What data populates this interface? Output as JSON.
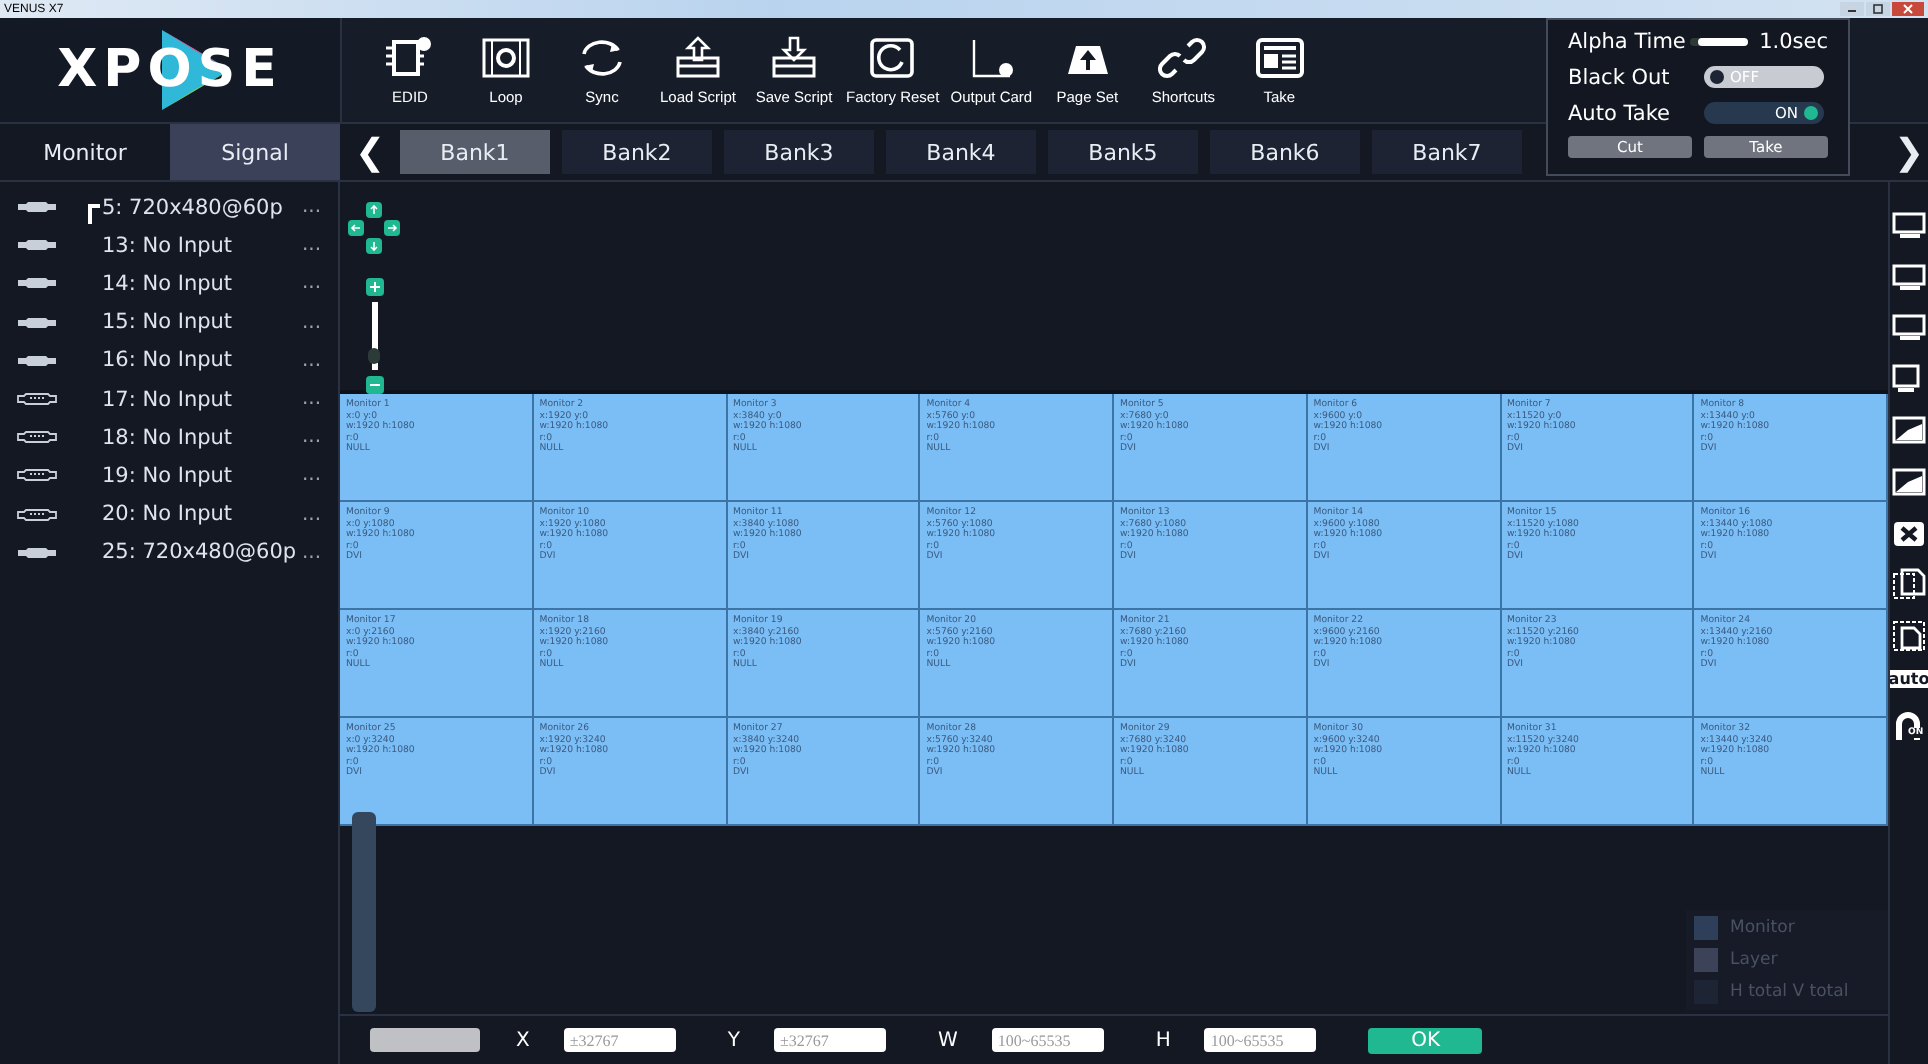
{
  "window": {
    "title": "VENUS X7"
  },
  "logo": {
    "text": "XPOSE"
  },
  "toolbar": [
    {
      "label": "EDID",
      "kind": "chip"
    },
    {
      "label": "Loop",
      "kind": "film"
    },
    {
      "label": "Sync",
      "kind": "sync"
    },
    {
      "label": "Load Script",
      "kind": "load"
    },
    {
      "label": "Save Script",
      "kind": "save"
    },
    {
      "label": "Factory Reset",
      "kind": "reset"
    },
    {
      "label": "Output Card",
      "kind": "card"
    },
    {
      "label": "Page Set",
      "kind": "cloud"
    },
    {
      "label": "Shortcuts",
      "kind": "link"
    },
    {
      "label": "Take",
      "kind": "take"
    }
  ],
  "left_tabs": [
    {
      "label": "Monitor",
      "selected": false
    },
    {
      "label": "Signal",
      "selected": true
    }
  ],
  "bank_nav": {
    "prev": "❮",
    "next": "❯"
  },
  "banks": [
    {
      "label": "Bank1",
      "selected": true
    },
    {
      "label": "Bank2",
      "selected": false
    },
    {
      "label": "Bank3",
      "selected": false
    },
    {
      "label": "Bank4",
      "selected": false
    },
    {
      "label": "Bank5",
      "selected": false
    },
    {
      "label": "Bank6",
      "selected": false
    },
    {
      "label": "Bank7",
      "selected": false
    }
  ],
  "signals": [
    {
      "label": "5: 720x480@60p",
      "kind": "hdmi",
      "selected": true,
      "menu": "..."
    },
    {
      "label": "13: No Input",
      "kind": "hdmi",
      "selected": false,
      "menu": "..."
    },
    {
      "label": "14: No Input",
      "kind": "hdmi",
      "selected": false,
      "menu": "..."
    },
    {
      "label": "15: No Input",
      "kind": "hdmi",
      "selected": false,
      "menu": "..."
    },
    {
      "label": "16: No Input",
      "kind": "hdmi",
      "selected": false,
      "menu": "..."
    },
    {
      "label": "17: No Input",
      "kind": "dvi",
      "selected": false,
      "menu": "..."
    },
    {
      "label": "18: No Input",
      "kind": "dvi",
      "selected": false,
      "menu": "..."
    },
    {
      "label": "19: No Input",
      "kind": "dvi",
      "selected": false,
      "menu": "..."
    },
    {
      "label": "20: No Input",
      "kind": "dvi",
      "selected": false,
      "menu": "..."
    },
    {
      "label": "25: 720x480@60p",
      "kind": "hdmi",
      "selected": false,
      "menu": "..."
    }
  ],
  "zoom": {
    "level": 0.1
  },
  "monitors": [
    {
      "title": "Monitor 1",
      "position": "x:0 y:0",
      "size": "w:1920 h:1080",
      "rotation": "r:0",
      "signal": "NULL"
    },
    {
      "title": "Monitor 2",
      "position": "x:1920 y:0",
      "size": "w:1920 h:1080",
      "rotation": "r:0",
      "signal": "NULL"
    },
    {
      "title": "Monitor 3",
      "position": "x:3840 y:0",
      "size": "w:1920 h:1080",
      "rotation": "r:0",
      "signal": "NULL"
    },
    {
      "title": "Monitor 4",
      "position": "x:5760 y:0",
      "size": "w:1920 h:1080",
      "rotation": "r:0",
      "signal": "NULL"
    },
    {
      "title": "Monitor 5",
      "position": "x:7680 y:0",
      "size": "w:1920 h:1080",
      "rotation": "r:0",
      "signal": "DVI"
    },
    {
      "title": "Monitor 6",
      "position": "x:9600 y:0",
      "size": "w:1920 h:1080",
      "rotation": "r:0",
      "signal": "DVI"
    },
    {
      "title": "Monitor 7",
      "position": "x:11520 y:0",
      "size": "w:1920 h:1080",
      "rotation": "r:0",
      "signal": "DVI"
    },
    {
      "title": "Monitor 8",
      "position": "x:13440 y:0",
      "size": "w:1920 h:1080",
      "rotation": "r:0",
      "signal": "DVI"
    },
    {
      "title": "Monitor 9",
      "position": "x:0 y:1080",
      "size": "w:1920 h:1080",
      "rotation": "r:0",
      "signal": "DVI"
    },
    {
      "title": "Monitor 10",
      "position": "x:1920 y:1080",
      "size": "w:1920 h:1080",
      "rotation": "r:0",
      "signal": "DVI"
    },
    {
      "title": "Monitor 11",
      "position": "x:3840 y:1080",
      "size": "w:1920 h:1080",
      "rotation": "r:0",
      "signal": "DVI"
    },
    {
      "title": "Monitor 12",
      "position": "x:5760 y:1080",
      "size": "w:1920 h:1080",
      "rotation": "r:0",
      "signal": "DVI"
    },
    {
      "title": "Monitor 13",
      "position": "x:7680 y:1080",
      "size": "w:1920 h:1080",
      "rotation": "r:0",
      "signal": "DVI"
    },
    {
      "title": "Monitor 14",
      "position": "x:9600 y:1080",
      "size": "w:1920 h:1080",
      "rotation": "r:0",
      "signal": "DVI"
    },
    {
      "title": "Monitor 15",
      "position": "x:11520 y:1080",
      "size": "w:1920 h:1080",
      "rotation": "r:0",
      "signal": "DVI"
    },
    {
      "title": "Monitor 16",
      "position": "x:13440 y:1080",
      "size": "w:1920 h:1080",
      "rotation": "r:0",
      "signal": "DVI"
    },
    {
      "title": "Monitor 17",
      "position": "x:0 y:2160",
      "size": "w:1920 h:1080",
      "rotation": "r:0",
      "signal": "NULL"
    },
    {
      "title": "Monitor 18",
      "position": "x:1920 y:2160",
      "size": "w:1920 h:1080",
      "rotation": "r:0",
      "signal": "NULL"
    },
    {
      "title": "Monitor 19",
      "position": "x:3840 y:2160",
      "size": "w:1920 h:1080",
      "rotation": "r:0",
      "signal": "NULL"
    },
    {
      "title": "Monitor 20",
      "position": "x:5760 y:2160",
      "size": "w:1920 h:1080",
      "rotation": "r:0",
      "signal": "NULL"
    },
    {
      "title": "Monitor 21",
      "position": "x:7680 y:2160",
      "size": "w:1920 h:1080",
      "rotation": "r:0",
      "signal": "DVI"
    },
    {
      "title": "Monitor 22",
      "position": "x:9600 y:2160",
      "size": "w:1920 h:1080",
      "rotation": "r:0",
      "signal": "DVI"
    },
    {
      "title": "Monitor 23",
      "position": "x:11520 y:2160",
      "size": "w:1920 h:1080",
      "rotation": "r:0",
      "signal": "DVI"
    },
    {
      "title": "Monitor 24",
      "position": "x:13440 y:2160",
      "size": "w:1920 h:1080",
      "rotation": "r:0",
      "signal": "DVI"
    },
    {
      "title": "Monitor 25",
      "position": "x:0 y:3240",
      "size": "w:1920 h:1080",
      "rotation": "r:0",
      "signal": "DVI"
    },
    {
      "title": "Monitor 26",
      "position": "x:1920 y:3240",
      "size": "w:1920 h:1080",
      "rotation": "r:0",
      "signal": "DVI"
    },
    {
      "title": "Monitor 27",
      "position": "x:3840 y:3240",
      "size": "w:1920 h:1080",
      "rotation": "r:0",
      "signal": "DVI"
    },
    {
      "title": "Monitor 28",
      "position": "x:5760 y:3240",
      "size": "w:1920 h:1080",
      "rotation": "r:0",
      "signal": "DVI"
    },
    {
      "title": "Monitor 29",
      "position": "x:7680 y:3240",
      "size": "w:1920 h:1080",
      "rotation": "r:0",
      "signal": "NULL"
    },
    {
      "title": "Monitor 30",
      "position": "x:9600 y:3240",
      "size": "w:1920 h:1080",
      "rotation": "r:0",
      "signal": "NULL"
    },
    {
      "title": "Monitor 31",
      "position": "x:11520 y:3240",
      "size": "w:1920 h:1080",
      "rotation": "r:0",
      "signal": "NULL"
    },
    {
      "title": "Monitor 32",
      "position": "x:13440 y:3240",
      "size": "w:1920 h:1080",
      "rotation": "r:0",
      "signal": "NULL"
    }
  ],
  "legend": [
    {
      "label": "Monitor",
      "color": "#2e3f5a"
    },
    {
      "label": "Layer",
      "color": "#3c4258"
    },
    {
      "label": "H total V total",
      "color": "#1d2433"
    }
  ],
  "bottom_bar": {
    "fields": [
      {
        "label": "X",
        "placeholder": "±32767"
      },
      {
        "label": "Y",
        "placeholder": "±32767"
      },
      {
        "label": "W",
        "placeholder": "100~65535"
      },
      {
        "label": "H",
        "placeholder": "100~65535"
      }
    ],
    "ok": "OK"
  },
  "panel": {
    "alpha_time": {
      "label": "Alpha Time",
      "level": 0.85,
      "reading": "1.0sec"
    },
    "black_out": {
      "label": "Black Out",
      "on": false,
      "state_text": "OFF"
    },
    "auto_take": {
      "label": "Auto Take",
      "on": true,
      "state_text": "ON"
    },
    "buttons": [
      "Cut",
      "Take"
    ]
  },
  "side_tools": [
    {
      "kind": "screen"
    },
    {
      "kind": "screen"
    },
    {
      "kind": "screen"
    },
    {
      "kind": "screen-small"
    },
    {
      "kind": "picture"
    },
    {
      "kind": "picture"
    },
    {
      "kind": "close"
    },
    {
      "kind": "copy"
    },
    {
      "kind": "paste"
    },
    {
      "kind": "text",
      "label": "auto"
    },
    {
      "kind": "magnet",
      "label": "ON"
    }
  ]
}
